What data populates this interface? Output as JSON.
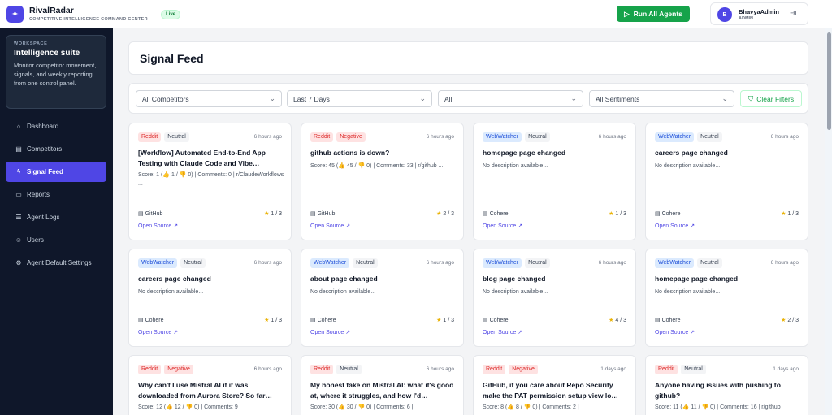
{
  "topbar": {
    "brand_name": "RivalRadar",
    "brand_sub": "COMPETITIVE INTELLIGENCE COMMAND CENTER",
    "live": "Live",
    "run_button": "Run All Agents",
    "user_initial": "B",
    "user_name": "BhavyaAdmin",
    "user_role": "ADMIN"
  },
  "sidebar": {
    "workspace_label": "WORKSPACE",
    "workspace_title": "Intelligence suite",
    "workspace_desc": "Monitor competitor movement, signals, and weekly reporting from one control panel.",
    "items": [
      {
        "label": "Dashboard",
        "icon": "grid-icon"
      },
      {
        "label": "Competitors",
        "icon": "building-icon"
      },
      {
        "label": "Signal Feed",
        "icon": "bolt-icon"
      },
      {
        "label": "Reports",
        "icon": "document-icon"
      },
      {
        "label": "Agent Logs",
        "icon": "list-icon"
      },
      {
        "label": "Users",
        "icon": "users-icon"
      },
      {
        "label": "Agent Default Settings",
        "icon": "gear-icon"
      }
    ]
  },
  "main": {
    "title": "Signal Feed",
    "filters": [
      "All Competitors",
      "Last 7 Days",
      "All",
      "All Sentiments"
    ],
    "clear_filters": "Clear Filters"
  },
  "cards": [
    {
      "source": "Reddit",
      "sentiment": "Neutral",
      "time": "6 hours ago",
      "title": "[Workflow] Automated End-to-End App Testing with Claude Code and Vibe…",
      "desc": "Score: 1 (👍 1 / 👎 0) | Comments: 0 | r/ClaudeWorkflows ...",
      "competitor": "GitHub",
      "rating": "1 / 3",
      "link": "Open Source ↗"
    },
    {
      "source": "Reddit",
      "sentiment": "Negative",
      "time": "6 hours ago",
      "title": "github actions is down?",
      "desc": "Score: 45 (👍 45 / 👎 0) | Comments: 33 | r/github ...",
      "competitor": "GitHub",
      "rating": "2 / 3",
      "link": "Open Source ↗"
    },
    {
      "source": "WebWatcher",
      "sentiment": "Neutral",
      "time": "6 hours ago",
      "title": "homepage page changed",
      "desc": "No description available...",
      "competitor": "Cohere",
      "rating": "1 / 3",
      "link": "Open Source ↗"
    },
    {
      "source": "WebWatcher",
      "sentiment": "Neutral",
      "time": "6 hours ago",
      "title": "careers page changed",
      "desc": "No description available...",
      "competitor": "Cohere",
      "rating": "1 / 3",
      "link": "Open Source ↗"
    },
    {
      "source": "WebWatcher",
      "sentiment": "Neutral",
      "time": "6 hours ago",
      "title": "careers page changed",
      "desc": "No description available...",
      "competitor": "Cohere",
      "rating": "1 / 3",
      "link": "Open Source ↗"
    },
    {
      "source": "WebWatcher",
      "sentiment": "Neutral",
      "time": "6 hours ago",
      "title": "about page changed",
      "desc": "No description available...",
      "competitor": "Cohere",
      "rating": "1 / 3",
      "link": "Open Source ↗"
    },
    {
      "source": "WebWatcher",
      "sentiment": "Neutral",
      "time": "6 hours ago",
      "title": "blog page changed",
      "desc": "No description available...",
      "competitor": "Cohere",
      "rating": "4 / 3",
      "link": "Open Source ↗"
    },
    {
      "source": "WebWatcher",
      "sentiment": "Neutral",
      "time": "6 hours ago",
      "title": "homepage page changed",
      "desc": "No description available...",
      "competitor": "Cohere",
      "rating": "2 / 3",
      "link": "Open Source ↗"
    },
    {
      "source": "Reddit",
      "sentiment": "Negative",
      "time": "6 hours ago",
      "title": "Why can't I use Mistral AI if it was downloaded from Aurora Store? So far…",
      "desc": "Score: 12 (👍 12 / 👎 0) | Comments: 9 |",
      "competitor": "",
      "rating": "",
      "link": ""
    },
    {
      "source": "Reddit",
      "sentiment": "Neutral",
      "time": "6 hours ago",
      "title": "My honest take on Mistral AI: what it's good at, where it struggles, and how I'd…",
      "desc": "Score: 30 (👍 30 / 👎 0) | Comments: 6 |",
      "competitor": "",
      "rating": "",
      "link": ""
    },
    {
      "source": "Reddit",
      "sentiment": "Negative",
      "time": "1 days ago",
      "title": "GitHub, if you care about Repo Security make the PAT permission setup view lo…",
      "desc": "Score: 8 (👍 8 / 👎 0) | Comments: 2 |",
      "competitor": "",
      "rating": "",
      "link": ""
    },
    {
      "source": "Reddit",
      "sentiment": "Neutral",
      "time": "1 days ago",
      "title": "Anyone having issues with pushing to github?",
      "desc": "Score: 11 (👍 11 / 👎 0) | Comments: 16 | r/github",
      "competitor": "",
      "rating": "",
      "link": ""
    }
  ]
}
